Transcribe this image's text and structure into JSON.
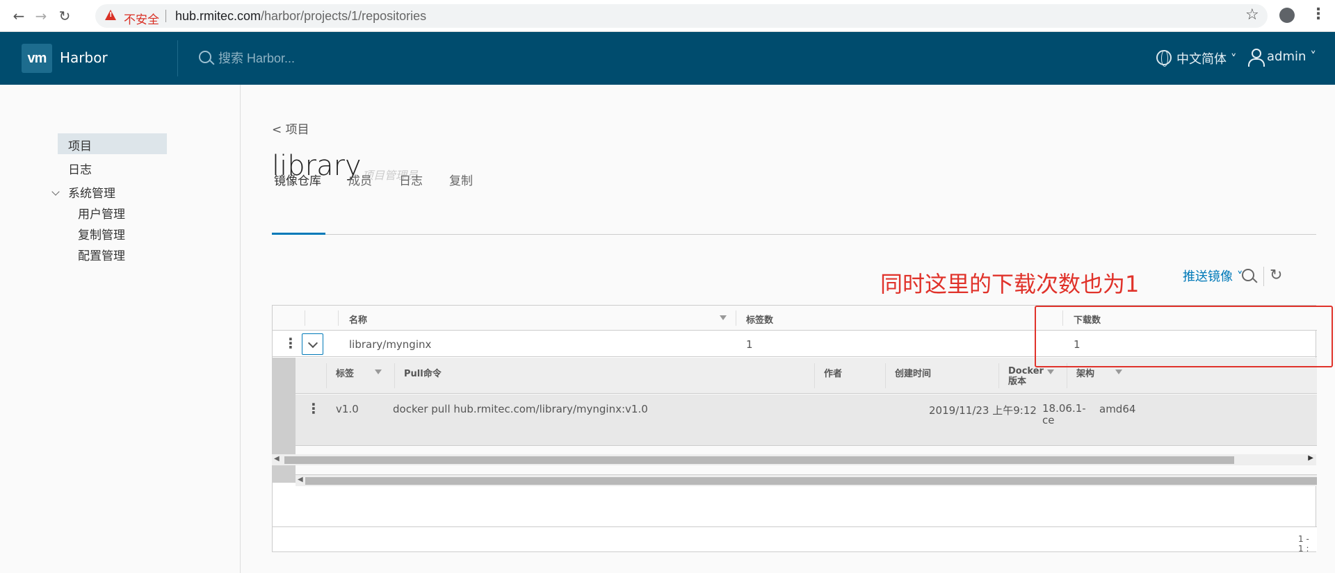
{
  "browser": {
    "insecure_label": "不安全",
    "url_host": "hub.rmitec.com",
    "url_path": "/harbor/projects/1/repositories",
    "back_glyph": "←",
    "forward_glyph": "→",
    "reload_glyph": "↻",
    "star_glyph": "☆",
    "menu_glyph": "⋮"
  },
  "header": {
    "logo": "vm",
    "brand": "Harbor",
    "search_placeholder": "搜索 Harbor...",
    "language": "中文简体 ˅",
    "user": "admin ˅"
  },
  "sidebar": {
    "items": [
      {
        "label": "项目"
      },
      {
        "label": "日志"
      },
      {
        "label": "系统管理"
      },
      {
        "label": "用户管理"
      },
      {
        "label": "复制管理"
      },
      {
        "label": "配置管理"
      }
    ]
  },
  "main": {
    "back_link": "< 项目",
    "title": "library",
    "role": "项目管理员",
    "tabs": [
      {
        "label": "镜像仓库"
      },
      {
        "label": "成员"
      },
      {
        "label": "日志"
      },
      {
        "label": "复制"
      }
    ]
  },
  "annotation": "同时这里的下载次数也为1",
  "toolbar": {
    "push_label": "推送镜像 ˅",
    "refresh_glyph": "↻"
  },
  "repo_table": {
    "columns": [
      "名称",
      "标签数",
      "下载数"
    ],
    "rows": [
      {
        "name": "library/mynginx",
        "tags": "1",
        "pulls": "1"
      }
    ],
    "kebab_glyph": "⋮",
    "footer": "1 - 1 :"
  },
  "tag_table": {
    "columns": [
      "标签",
      "Pull命令",
      "作者",
      "创建时间",
      "Docker版本",
      "架构"
    ],
    "rows": [
      {
        "tag": "v1.0",
        "pull": "docker pull hub.rmitec.com/library/mynginx:v1.0",
        "author": "",
        "created": "2019/11/23 上午9:12",
        "docker_ver": "18.06.1-ce",
        "arch": "amd64"
      }
    ],
    "footer": "1 -"
  }
}
